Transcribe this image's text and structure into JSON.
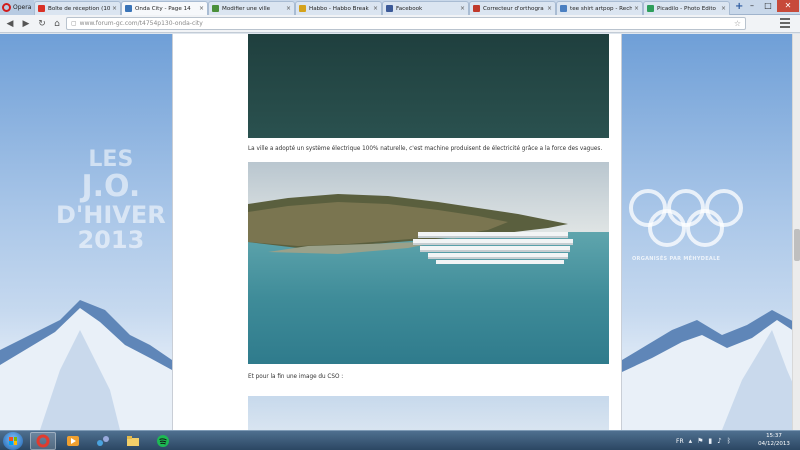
{
  "browser": {
    "opera_label": "Opera",
    "tabs": [
      {
        "title": "Boîte de réception (10",
        "icon_color": "#d93025",
        "icon": "gmail-icon"
      },
      {
        "title": "Onda City - Page 14",
        "icon_color": "#3a74b8",
        "icon": "forum-icon",
        "active": true
      },
      {
        "title": "Modifier une ville",
        "icon_color": "#4a8f3a",
        "icon": "globe-icon"
      },
      {
        "title": "Habbo - Habbo Break",
        "icon_color": "#d5a21b",
        "icon": "habbo-icon"
      },
      {
        "title": "Facebook",
        "icon_color": "#3b5998",
        "icon": "facebook-icon"
      },
      {
        "title": "Correcteur d'orthogra",
        "icon_color": "#c0392b",
        "icon": "spellcheck-icon"
      },
      {
        "title": "tee shirt artpop - Rech",
        "icon_color": "#4a7fc1",
        "icon": "search-icon"
      },
      {
        "title": "Picadilo - Photo Edito",
        "icon_color": "#2e9e5b",
        "icon": "picadilo-icon"
      }
    ],
    "url_host": "www.forum-gc.com",
    "url_path": "/t4754p130-onda-city"
  },
  "banner": {
    "line1": "LES",
    "line2": "J.O.",
    "line3": "D'HIVER",
    "line4": "2013",
    "rings_caption": "ORGANISÉS PAR MÉHYDEALE"
  },
  "post": {
    "caption_1": "La ville a adopté un système électrique 100% naturelle, c'est machine produisent de électricité grâce a la force des vagues.",
    "caption_2": "Et pour la fin une image du CSO :"
  },
  "taskbar": {
    "language": "FR",
    "time": "15:37",
    "date": "04/12/2013"
  }
}
